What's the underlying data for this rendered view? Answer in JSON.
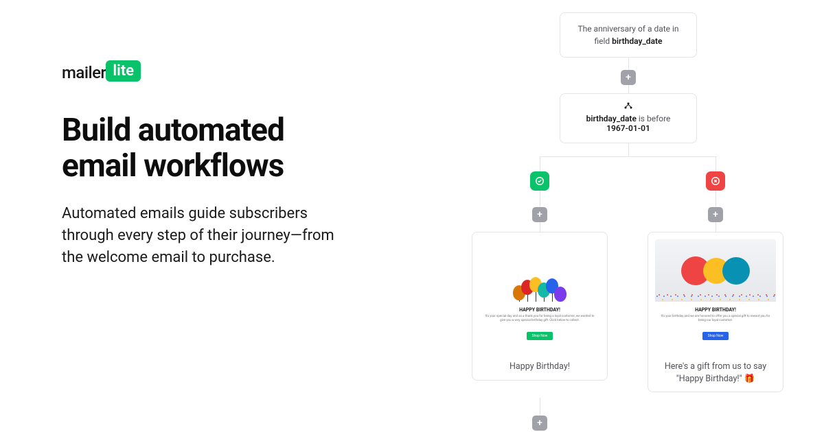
{
  "logo": {
    "mailer": "mailer",
    "lite": "lite"
  },
  "headline": "Build automated email workflows",
  "subheadline": "Automated emails guide subscribers through every step of their journey—from the welcome email to purchase.",
  "workflow": {
    "trigger": {
      "prefix": "The anniversary of a date in field ",
      "field": "birthday_date"
    },
    "condition": {
      "field": "birthday_date",
      "mid": " is before ",
      "value": "1967-01-01"
    },
    "add_label": "+",
    "branch_true_icon": "check-circle-icon",
    "branch_false_icon": "x-circle-icon",
    "emails": {
      "left": {
        "preview_heading": "HAPPY BIRTHDAY!",
        "preview_text": "It's your special day and as a thank you for being a loyal customer, we wanted to give you a very special birthday gift. Click below to collect.",
        "preview_button": "Shop Now",
        "title": "Happy Birthday!"
      },
      "right": {
        "preview_heading": "HAPPY BIRTHDAY!",
        "preview_text": "It's your birthday and we are honored to offer you a special gift to reward you for being our loyal customer.",
        "preview_button": "Shop Now",
        "title": "Here's a gift from us to say \"Happy Birthday!\" 🎁"
      }
    }
  }
}
